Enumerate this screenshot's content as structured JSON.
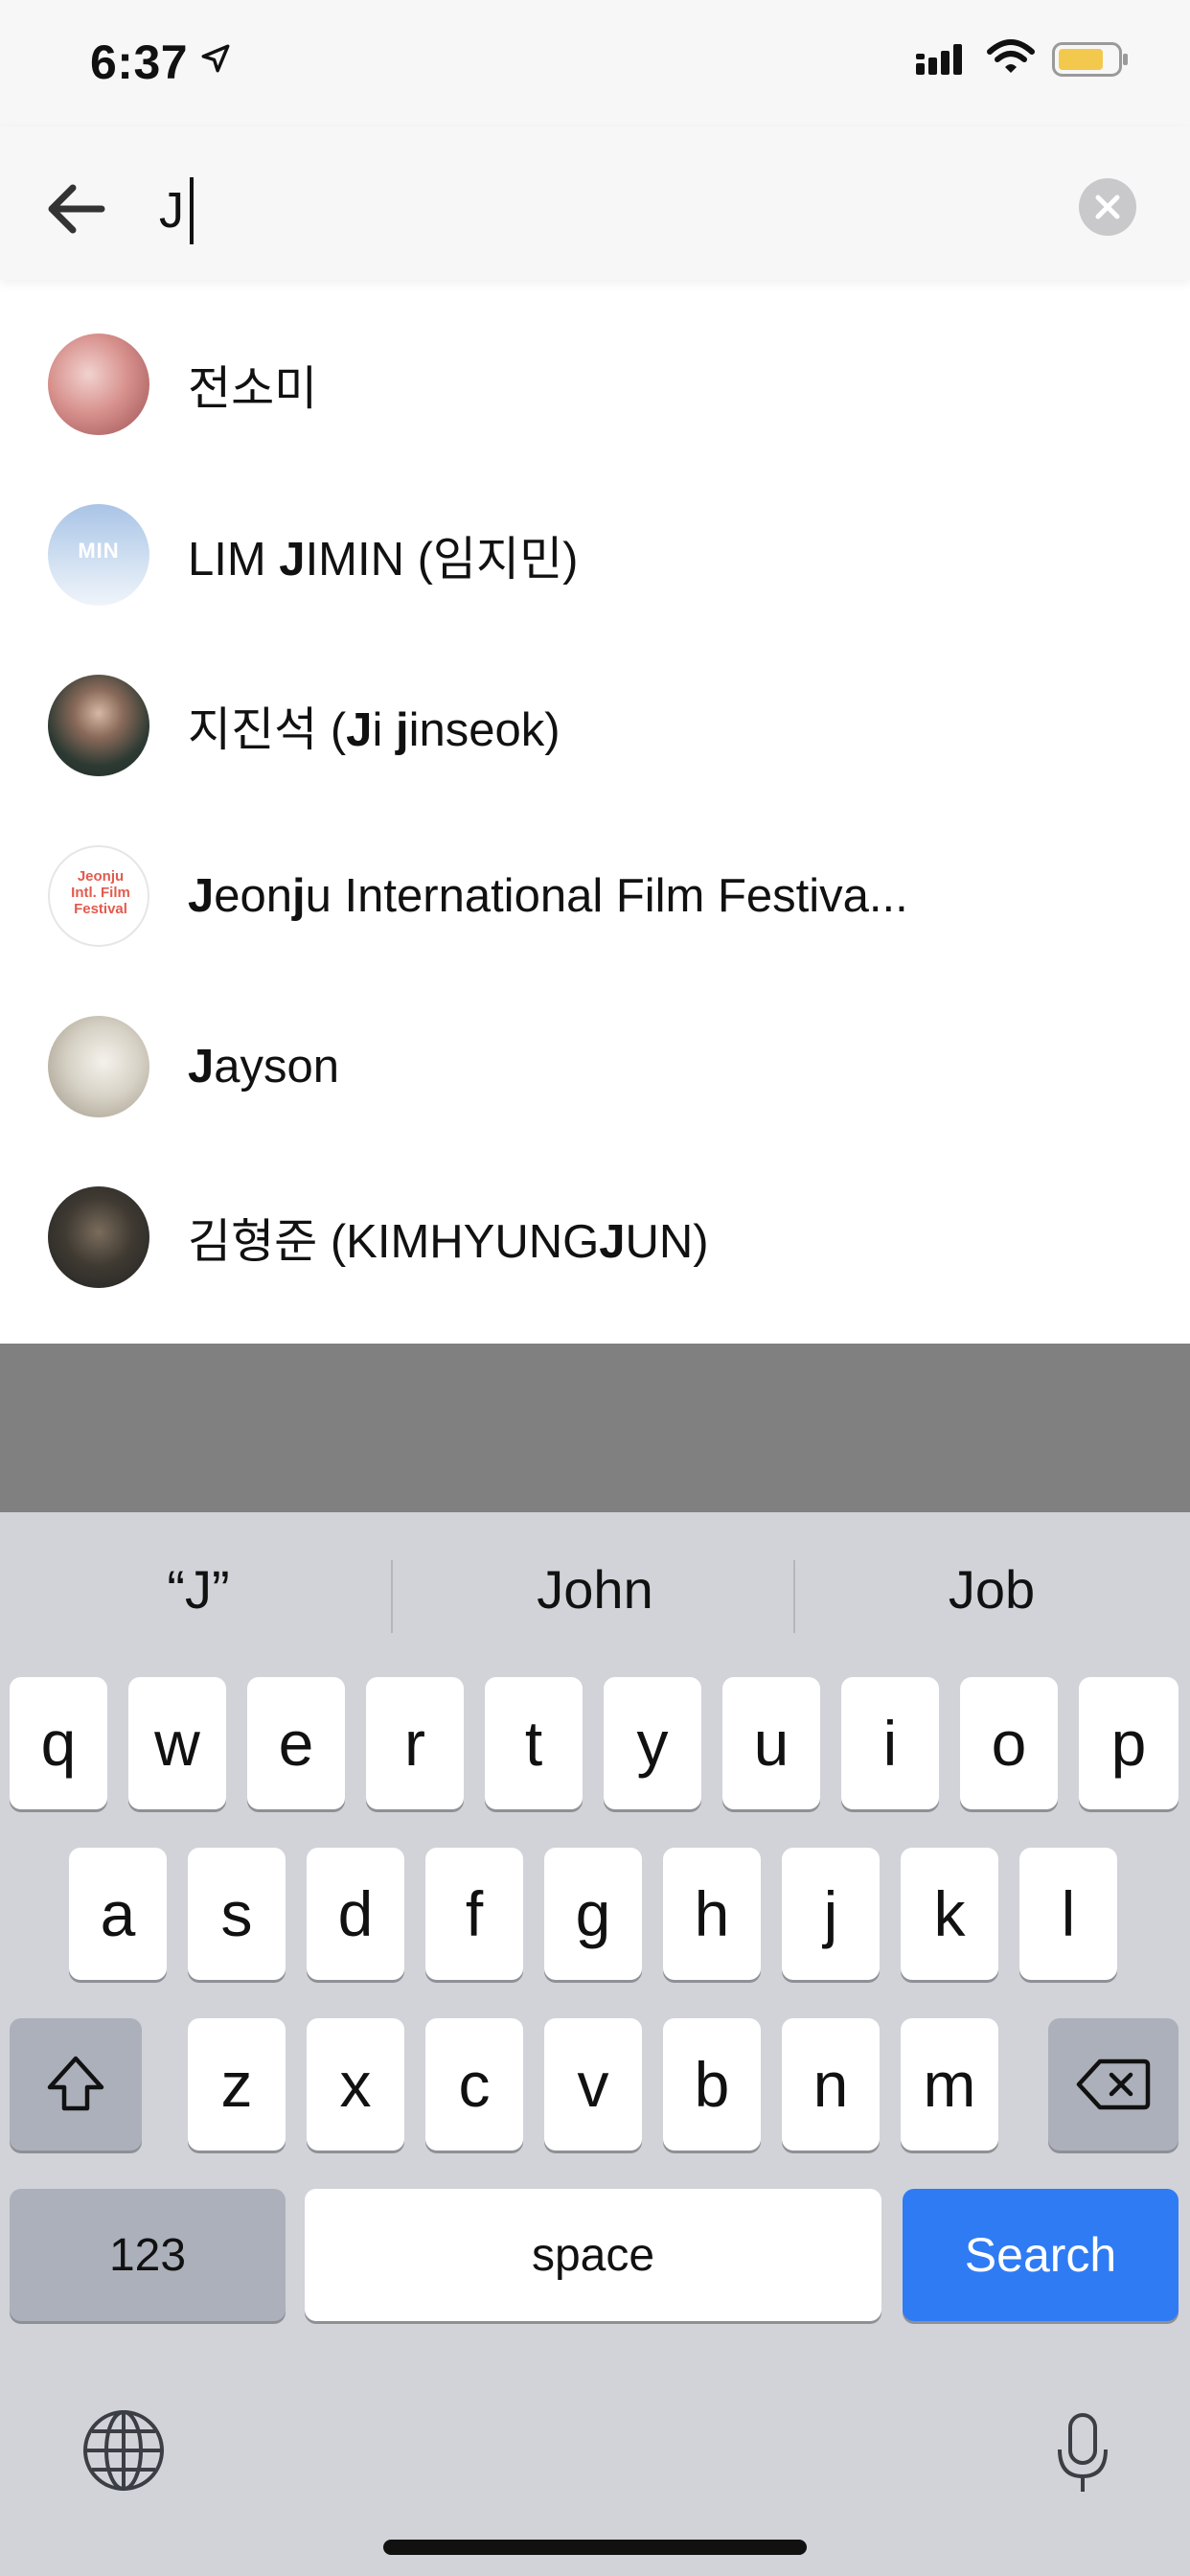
{
  "status_bar": {
    "time": "6:37",
    "icons": [
      "location-arrow-icon",
      "signal-icon",
      "wifi-icon",
      "battery-icon"
    ],
    "battery_color": "#f2c94c"
  },
  "search": {
    "value": "J",
    "back_icon": "arrow-left-icon",
    "clear_icon": "clear-circle-icon"
  },
  "results": [
    {
      "name_html": "전소미",
      "avatar_text": ""
    },
    {
      "name_html": "LIM <b>J</b>IMIN (임지민)",
      "avatar_text": "MIN"
    },
    {
      "name_html": "지진석 (<b>J</b>i <b>j</b>inseok)",
      "avatar_text": ""
    },
    {
      "name_html": "<b>J</b>eon<b>j</b>u International Film Festiva...",
      "avatar_text": "Jeonju Intl. Film Festival"
    },
    {
      "name_html": "<b>J</b>ayson",
      "avatar_text": ""
    },
    {
      "name_html": "김형준 (KIMHYUNG<b>J</b>UN)",
      "avatar_text": ""
    }
  ],
  "keyboard": {
    "suggestions": [
      "“J”",
      "John",
      "Job"
    ],
    "row1": [
      "q",
      "w",
      "e",
      "r",
      "t",
      "y",
      "u",
      "i",
      "o",
      "p"
    ],
    "row2": [
      "a",
      "s",
      "d",
      "f",
      "g",
      "h",
      "j",
      "k",
      "l"
    ],
    "row3": [
      "z",
      "x",
      "c",
      "v",
      "b",
      "n",
      "m"
    ],
    "numbers_label": "123",
    "space_label": "space",
    "search_label": "Search",
    "accent_color": "#2f7bf4"
  }
}
